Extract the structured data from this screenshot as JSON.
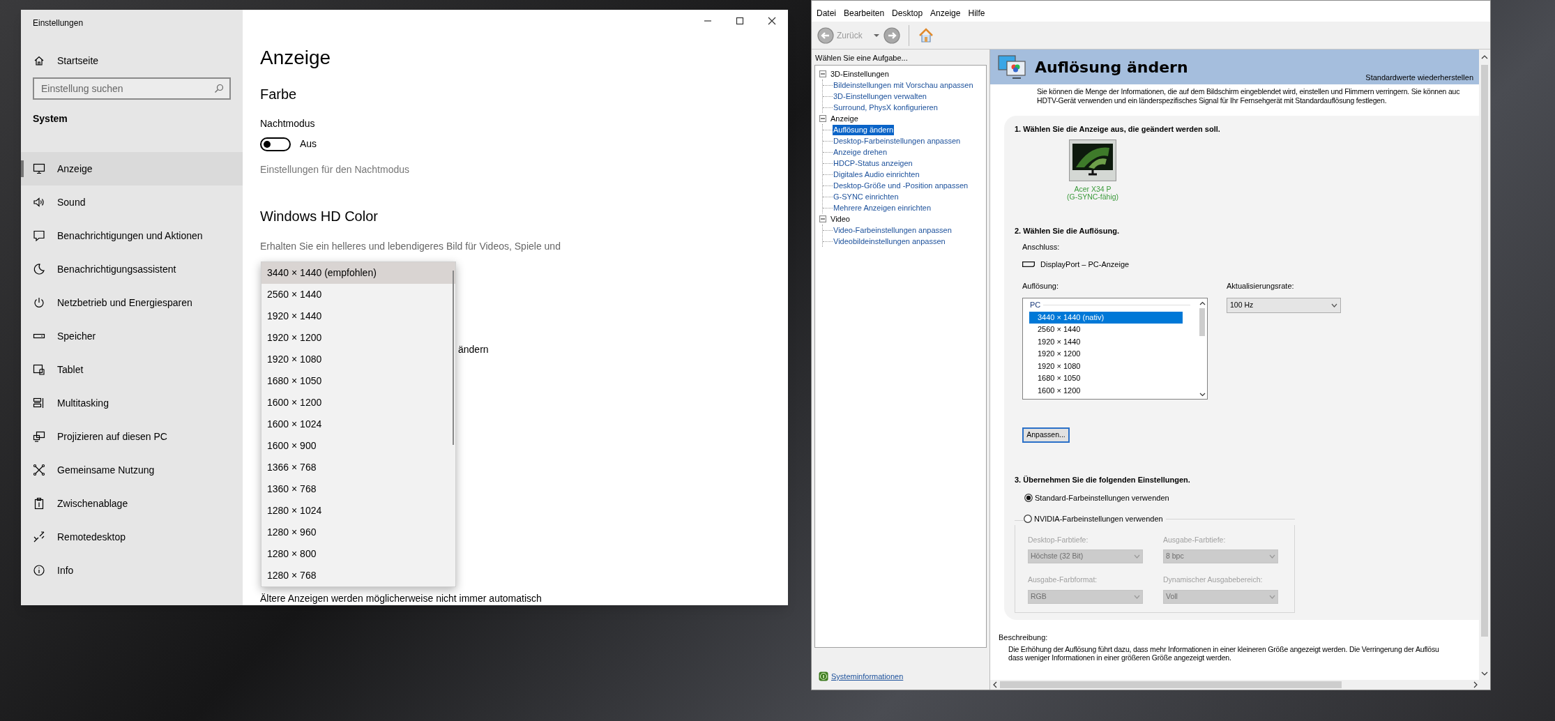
{
  "settings_window": {
    "title": "Einstellungen",
    "home": "Startseite",
    "search": {
      "placeholder": "Einstellung suchen"
    },
    "section": "System",
    "nav": [
      {
        "label": "Anzeige",
        "selected": true
      },
      {
        "label": "Sound",
        "selected": false
      },
      {
        "label": "Benachrichtigungen und Aktionen",
        "selected": false
      },
      {
        "label": "Benachrichtigungsassistent",
        "selected": false
      },
      {
        "label": "Netzbetrieb und Energiesparen",
        "selected": false
      },
      {
        "label": "Speicher",
        "selected": false
      },
      {
        "label": "Tablet",
        "selected": false
      },
      {
        "label": "Multitasking",
        "selected": false
      },
      {
        "label": "Projizieren auf diesen PC",
        "selected": false
      },
      {
        "label": "Gemeinsame Nutzung",
        "selected": false
      },
      {
        "label": "Zwischenablage",
        "selected": false
      },
      {
        "label": "Remotedesktop",
        "selected": false
      },
      {
        "label": "Info",
        "selected": false
      }
    ],
    "page_title": "Anzeige",
    "color_heading": "Farbe",
    "night_mode": {
      "label": "Nachtmodus",
      "on": false,
      "state_text": "Aus",
      "link": "Einstellungen für den Nachtmodus"
    },
    "hd_heading": "Windows HD Color",
    "hd_description": "Erhalten Sie ein helleres und lebendigeres Bild für Videos, Spiele und",
    "covered_text_fragment": "ändern",
    "bottom_text": "Ältere Anzeigen werden möglicherweise nicht immer automatisch",
    "resolution_dropdown": [
      {
        "label": "3440 × 1440 (empfohlen)",
        "selected": true
      },
      {
        "label": "2560 × 1440",
        "selected": false
      },
      {
        "label": "1920 × 1440",
        "selected": false
      },
      {
        "label": "1920 × 1200",
        "selected": false
      },
      {
        "label": "1920 × 1080",
        "selected": false
      },
      {
        "label": "1680 × 1050",
        "selected": false
      },
      {
        "label": "1600 × 1200",
        "selected": false
      },
      {
        "label": "1600 × 1024",
        "selected": false
      },
      {
        "label": "1600 × 900",
        "selected": false
      },
      {
        "label": "1366 × 768",
        "selected": false
      },
      {
        "label": "1360 × 768",
        "selected": false
      },
      {
        "label": "1280 × 1024",
        "selected": false
      },
      {
        "label": "1280 × 960",
        "selected": false
      },
      {
        "label": "1280 × 800",
        "selected": false
      },
      {
        "label": "1280 × 768",
        "selected": false
      }
    ]
  },
  "nvidia_window": {
    "menu": [
      "Datei",
      "Bearbeiten",
      "Desktop",
      "Anzeige",
      "Hilfe"
    ],
    "back": {
      "label": "Zurück",
      "disabled": true
    },
    "task_label": "Wählen Sie eine Aufgabe...",
    "tree": [
      {
        "label": "3D-Einstellungen",
        "expanded": true,
        "children": [
          {
            "label": "Bildeinstellungen mit Vorschau anpassen",
            "selected": false
          },
          {
            "label": "3D-Einstellungen verwalten",
            "selected": false
          },
          {
            "label": "Surround, PhysX konfigurieren",
            "selected": false
          }
        ]
      },
      {
        "label": "Anzeige",
        "expanded": true,
        "children": [
          {
            "label": "Auflösung ändern",
            "selected": true
          },
          {
            "label": "Desktop-Farbeinstellungen anpassen",
            "selected": false
          },
          {
            "label": "Anzeige drehen",
            "selected": false
          },
          {
            "label": "HDCP-Status anzeigen",
            "selected": false
          },
          {
            "label": "Digitales Audio einrichten",
            "selected": false
          },
          {
            "label": "Desktop-Größe und -Position anpassen",
            "selected": false
          },
          {
            "label": "G-SYNC einrichten",
            "selected": false
          },
          {
            "label": "Mehrere Anzeigen einrichten",
            "selected": false
          }
        ]
      },
      {
        "label": "Video",
        "expanded": true,
        "children": [
          {
            "label": "Video-Farbeinstellungen anpassen",
            "selected": false
          },
          {
            "label": "Videobildeinstellungen anpassen",
            "selected": false
          }
        ]
      }
    ],
    "sysinfo_link": "Systeminformationen",
    "page": {
      "title": "Auflösung ändern",
      "restore": "Standardwerte wiederherstellen",
      "intro": [
        "Sie können die Menge der Informationen, die auf dem Bildschirm eingeblendet wird, einstellen und Flimmern verringern. Sie können auc",
        "HDTV-Gerät verwenden und ein länderspezifisches Signal für Ihr Fernsehgerät mit Standardauflösung festlegen."
      ],
      "step1": "1. Wählen Sie die Anzeige aus, die geändert werden soll.",
      "display": {
        "name": "Acer X34 P",
        "note": "(G-SYNC-fähig)",
        "selected": true
      },
      "step2": "2. Wählen Sie die Auflösung.",
      "connection_label": "Anschluss:",
      "connection": "DisplayPort – PC-Anzeige",
      "resolution_label": "Auflösung:",
      "resolution_list": {
        "group": "PC",
        "items": [
          {
            "label": "3440 × 1440 (nativ)",
            "selected": true
          },
          {
            "label": "2560 × 1440",
            "selected": false
          },
          {
            "label": "1920 × 1440",
            "selected": false
          },
          {
            "label": "1920 × 1200",
            "selected": false
          },
          {
            "label": "1920 × 1080",
            "selected": false
          },
          {
            "label": "1680 × 1050",
            "selected": false
          },
          {
            "label": "1600 × 1200",
            "selected": false
          }
        ]
      },
      "refresh_label": "Aktualisierungsrate:",
      "refresh_value": "100 Hz",
      "customize": "Anpassen...",
      "step3": "3. Übernehmen Sie die folgenden Einstellungen.",
      "color_options": [
        {
          "label": "Standard-Farbeinstellungen verwenden",
          "selected": true
        },
        {
          "label": "NVIDIA-Farbeinstellungen verwenden",
          "selected": false
        }
      ],
      "color_fields": [
        {
          "label": "Desktop-Farbtiefe:",
          "value": "Höchste (32 Bit)",
          "disabled": true
        },
        {
          "label": "Ausgabe-Farbtiefe:",
          "value": "8 bpc",
          "disabled": true
        },
        {
          "label": "Ausgabe-Farbformat:",
          "value": "RGB",
          "disabled": true
        },
        {
          "label": "Dynamischer Ausgabebereich:",
          "value": "Voll",
          "disabled": true
        }
      ],
      "description_label": "Beschreibung:",
      "description": [
        "Die Erhöhung der Auflösung führt dazu, dass mehr Informationen in einer kleineren Größe angezeigt werden. Die Verringerung der Auflösu",
        "dass weniger Informationen in einer größeren Größe angezeigt werden."
      ]
    }
  }
}
